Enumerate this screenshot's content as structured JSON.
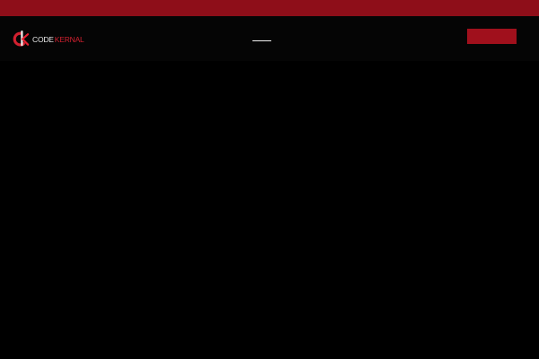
{
  "brand": {
    "logo_primary": "CODE",
    "logo_secondary": "KERNAL",
    "logo_icon": "ck-monogram-icon",
    "colors": {
      "top_strip": "#8e0e19",
      "accent": "#d1202f",
      "cta": "#a0101c",
      "background": "#000000"
    }
  },
  "header": {
    "menu_icon": "hamburger-icon",
    "cta_label": ""
  }
}
